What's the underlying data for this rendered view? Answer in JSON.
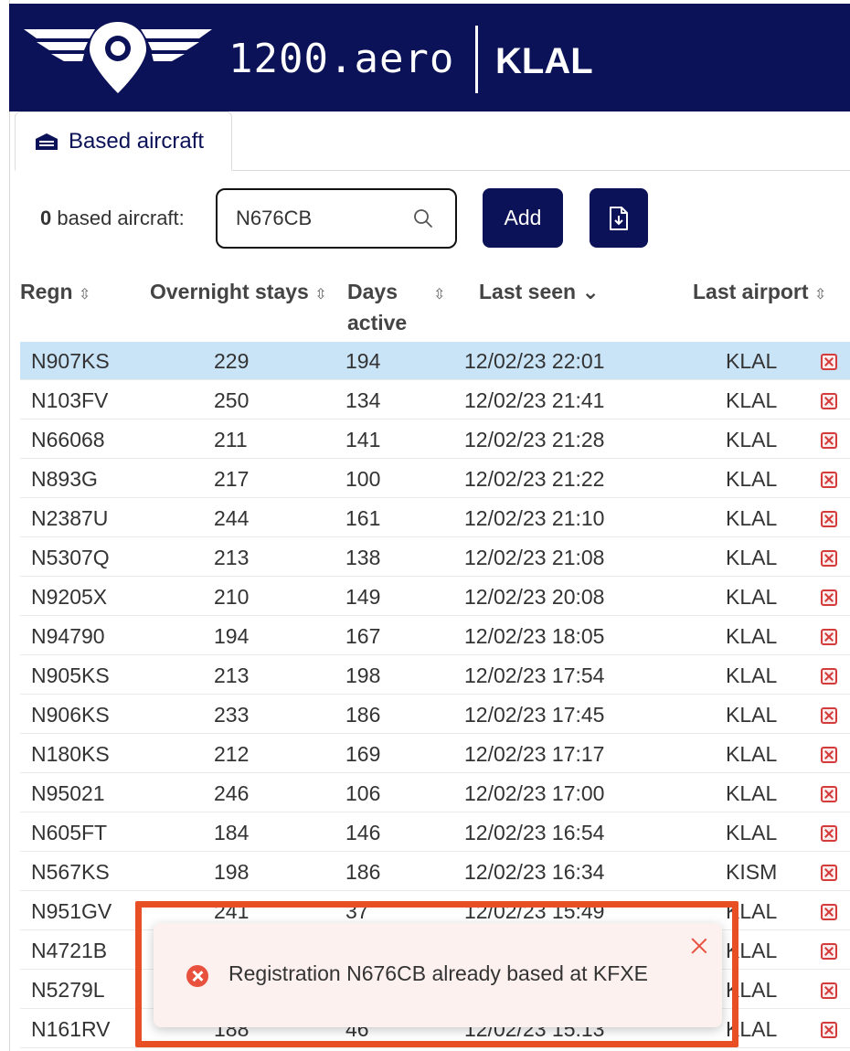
{
  "header": {
    "brand": "1200.aero",
    "airport_code": "KLAL",
    "bg_color": "#0b1257"
  },
  "tabs": [
    {
      "label": "Based aircraft",
      "icon": "hangar-icon",
      "active": true
    }
  ],
  "toolbar": {
    "count": "0",
    "count_label": " based aircraft:",
    "search_value": "N676CB",
    "search_icon": "search-icon",
    "add_label": "Add",
    "export_icon": "download-file-icon"
  },
  "table": {
    "columns": [
      {
        "label": "Regn",
        "sort": "⇳"
      },
      {
        "label": "Overnight stays",
        "sort": "⇳"
      },
      {
        "label": "Days",
        "label2": "active",
        "sort": "⇳"
      },
      {
        "label": "Last seen",
        "sort": "⌄"
      },
      {
        "label": "Last airport",
        "sort": "⇳"
      }
    ],
    "rows": [
      {
        "regn": "N907KS",
        "stays": "229",
        "days": "194",
        "last_seen": "12/02/23 22:01",
        "airport": "KLAL",
        "selected": true
      },
      {
        "regn": "N103FV",
        "stays": "250",
        "days": "134",
        "last_seen": "12/02/23 21:41",
        "airport": "KLAL"
      },
      {
        "regn": "N66068",
        "stays": "211",
        "days": "141",
        "last_seen": "12/02/23 21:28",
        "airport": "KLAL"
      },
      {
        "regn": "N893G",
        "stays": "217",
        "days": "100",
        "last_seen": "12/02/23 21:22",
        "airport": "KLAL"
      },
      {
        "regn": "N2387U",
        "stays": "244",
        "days": "161",
        "last_seen": "12/02/23 21:10",
        "airport": "KLAL"
      },
      {
        "regn": "N5307Q",
        "stays": "213",
        "days": "138",
        "last_seen": "12/02/23 21:08",
        "airport": "KLAL"
      },
      {
        "regn": "N9205X",
        "stays": "210",
        "days": "149",
        "last_seen": "12/02/23 20:08",
        "airport": "KLAL"
      },
      {
        "regn": "N94790",
        "stays": "194",
        "days": "167",
        "last_seen": "12/02/23 18:05",
        "airport": "KLAL"
      },
      {
        "regn": "N905KS",
        "stays": "213",
        "days": "198",
        "last_seen": "12/02/23 17:54",
        "airport": "KLAL"
      },
      {
        "regn": "N906KS",
        "stays": "233",
        "days": "186",
        "last_seen": "12/02/23 17:45",
        "airport": "KLAL"
      },
      {
        "regn": "N180KS",
        "stays": "212",
        "days": "169",
        "last_seen": "12/02/23 17:17",
        "airport": "KLAL"
      },
      {
        "regn": "N95021",
        "stays": "246",
        "days": "106",
        "last_seen": "12/02/23 17:00",
        "airport": "KLAL"
      },
      {
        "regn": "N605FT",
        "stays": "184",
        "days": "146",
        "last_seen": "12/02/23 16:54",
        "airport": "KLAL"
      },
      {
        "regn": "N567KS",
        "stays": "198",
        "days": "186",
        "last_seen": "12/02/23 16:34",
        "airport": "KISM"
      },
      {
        "regn": "N951GV",
        "stays": "241",
        "days": "37",
        "last_seen": "12/02/23 15:49",
        "airport": "KLAL"
      },
      {
        "regn": "N4721B",
        "stays": "",
        "days": "",
        "last_seen": "",
        "airport": "KLAL"
      },
      {
        "regn": "N5279L",
        "stays": "",
        "days": "",
        "last_seen": "",
        "airport": "KLAL"
      },
      {
        "regn": "N161RV",
        "stays": "188",
        "days": "46",
        "last_seen": "12/02/23 15:13",
        "airport": "KLAL"
      }
    ]
  },
  "toast": {
    "message": "Registration N676CB already based at KFXE",
    "icon": "error-icon",
    "close_icon": "close-icon",
    "accent_color": "#e8513e"
  },
  "colors": {
    "selected_row": "#c9e3f7",
    "delete_icon": "#d43b3b",
    "highlight_box": "#e94f25"
  }
}
